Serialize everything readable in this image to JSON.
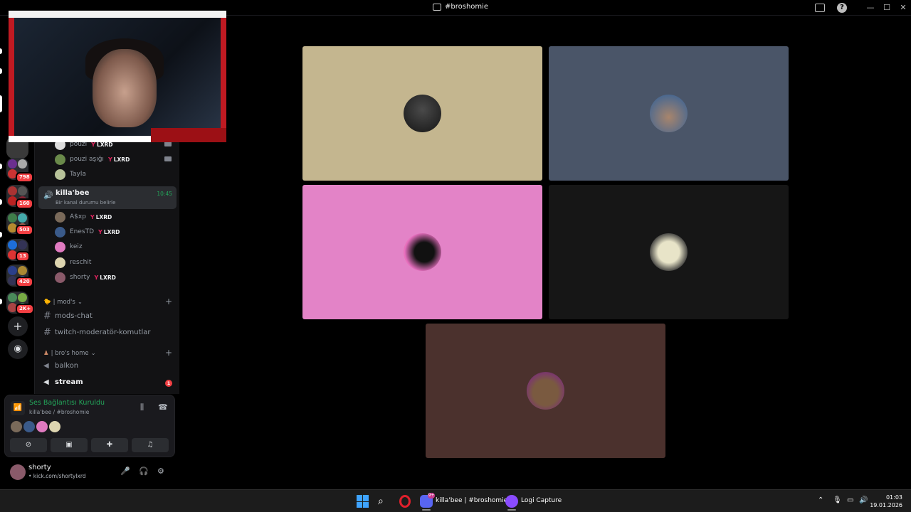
{
  "window": {
    "title": "#broshomie"
  },
  "servers": [
    {
      "badge": "798"
    },
    {
      "badge": "160"
    },
    {
      "badge": "503"
    },
    {
      "badge": "13"
    },
    {
      "badge": "420"
    },
    {
      "badge": "2K+"
    }
  ],
  "voice_users_top": [
    {
      "name": "pouzi",
      "tag": "LXRD"
    },
    {
      "name": "pouzi aşığı",
      "tag": "LXRD"
    },
    {
      "name": "Tayla",
      "tag": ""
    }
  ],
  "active_channel": {
    "name": "killa'bee",
    "time": "10:45",
    "status": "Bir kanal durumu belirle"
  },
  "voice_users": [
    {
      "name": "A$xp",
      "tag": "LXRD"
    },
    {
      "name": "EnesTD",
      "tag": "LXRD"
    },
    {
      "name": "keiz",
      "tag": ""
    },
    {
      "name": "reschit",
      "tag": ""
    },
    {
      "name": "shorty",
      "tag": "LXRD"
    }
  ],
  "categories": {
    "mods": "| mod's",
    "bros": "| bro's home"
  },
  "channels": {
    "mods_chat": "mods-chat",
    "twitch_mod": "twitch-moderatör-komutlar",
    "balkon": "balkon",
    "stream": "stream",
    "stream_unread": "1"
  },
  "voice_panel": {
    "status": "Ses Bağlantısı Kuruldu",
    "location": "killa'bee / #broshomie"
  },
  "user_panel": {
    "name": "shorty",
    "status": "• kick.com/shortylxrd"
  },
  "participant_tiles": [
    {
      "bg": "#c4b68f"
    },
    {
      "bg": "#4a5568"
    },
    {
      "bg": "#e383c7"
    },
    {
      "bg": "#161616"
    },
    {
      "bg": "#4b312d"
    }
  ],
  "taskbar": {
    "discord_label": "killa'bee | #broshomie -",
    "discord_badge": "9+",
    "logi_label": "Logi Capture",
    "time": "01:03",
    "date": "19.01.2026"
  },
  "colors": {
    "accent_green": "#23a55a",
    "badge_red": "#f23f43",
    "tag_red": "#e0245e"
  }
}
